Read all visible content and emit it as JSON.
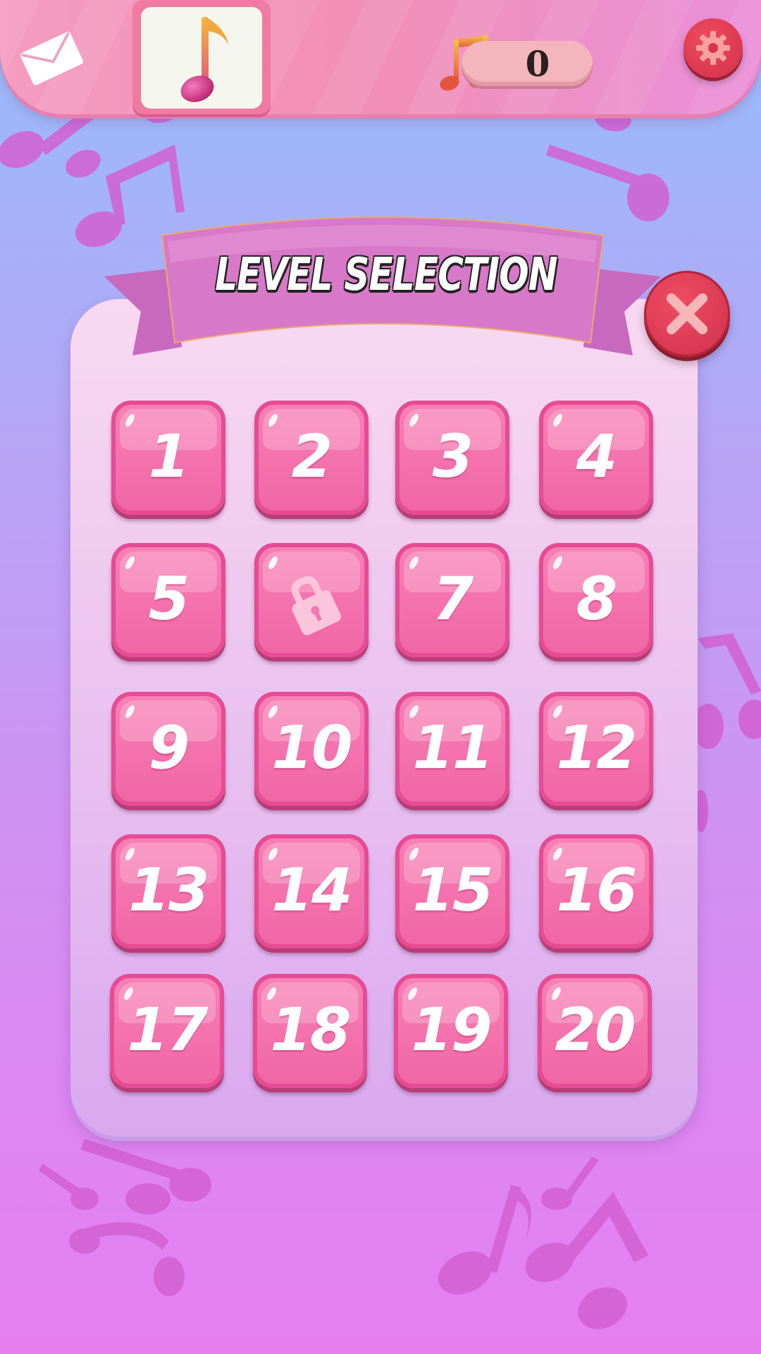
{
  "header": {
    "mail_icon": "envelope-icon",
    "song_icon": "music-note-icon",
    "score_icon": "double-music-note-icon",
    "score_value": "0",
    "settings_icon": "gear-icon"
  },
  "dialog": {
    "title": "LEVEL SELECTION",
    "close_icon": "close-icon"
  },
  "levels": [
    {
      "label": "1",
      "locked": false
    },
    {
      "label": "2",
      "locked": false
    },
    {
      "label": "3",
      "locked": false
    },
    {
      "label": "4",
      "locked": false
    },
    {
      "label": "5",
      "locked": false
    },
    {
      "label": "",
      "locked": true,
      "icon": "lock-icon"
    },
    {
      "label": "7",
      "locked": false
    },
    {
      "label": "8",
      "locked": false
    },
    {
      "label": "9",
      "locked": false
    },
    {
      "label": "10",
      "locked": false
    },
    {
      "label": "11",
      "locked": false
    },
    {
      "label": "12",
      "locked": false
    },
    {
      "label": "13",
      "locked": false
    },
    {
      "label": "14",
      "locked": false
    },
    {
      "label": "15",
      "locked": false
    },
    {
      "label": "16",
      "locked": false
    },
    {
      "label": "17",
      "locked": false
    },
    {
      "label": "18",
      "locked": false
    },
    {
      "label": "19",
      "locked": false
    },
    {
      "label": "20",
      "locked": false
    }
  ],
  "colors": {
    "level_button": "#f070aa",
    "close_button": "#d9354f",
    "banner": "#d97ac9"
  }
}
